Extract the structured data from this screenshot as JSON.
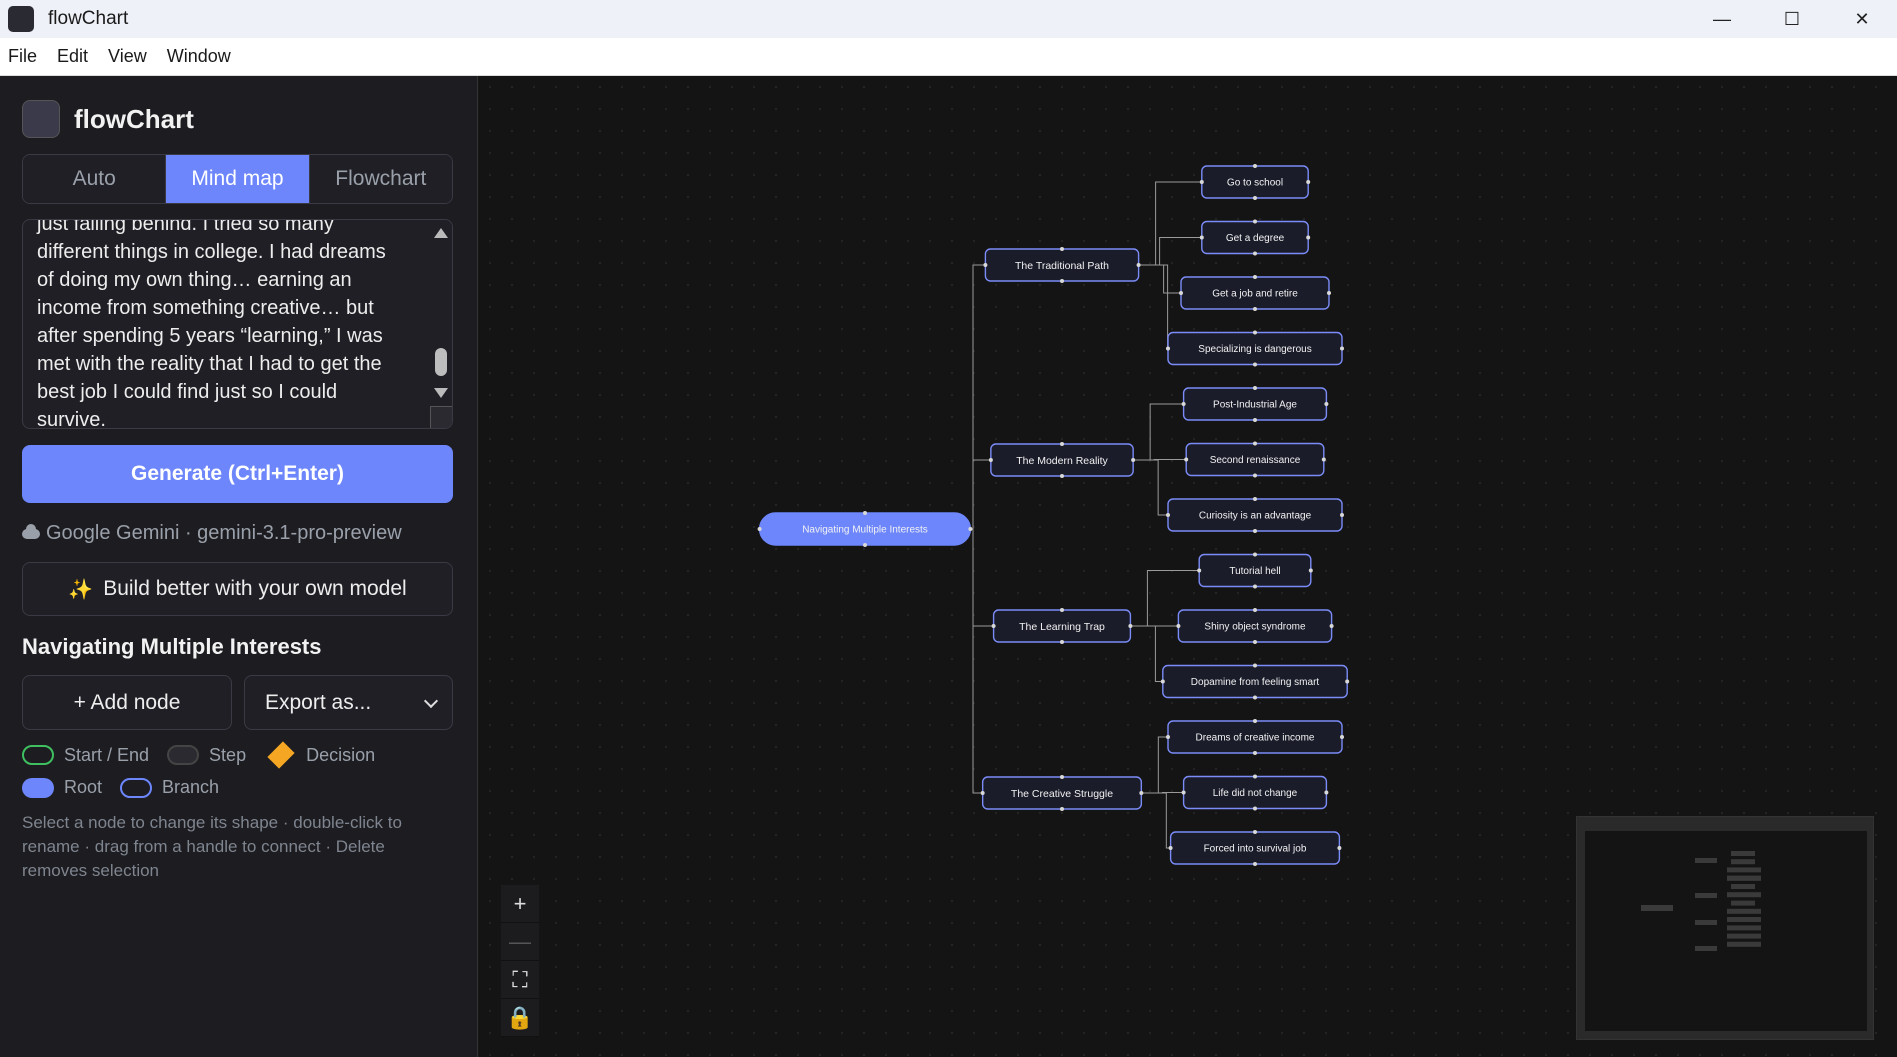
{
  "window": {
    "title": "flowChart",
    "controls": {
      "minimize": "—",
      "maximize": "☐",
      "close": "✕"
    }
  },
  "menu": [
    "File",
    "Edit",
    "View",
    "Window"
  ],
  "sidebar": {
    "brand": "flowChart",
    "tabs": [
      {
        "label": "Auto",
        "active": false
      },
      {
        "label": "Mind map",
        "active": true
      },
      {
        "label": "Flowchart",
        "active": false
      }
    ],
    "input_lines": [
      "just falling behind. I tried so many",
      "different things in college. I had dreams",
      "of doing my own thing… earning an",
      "income from something creative… but",
      "after spending 5 years “learning,” I was",
      "met with the reality that I had to get the",
      "best job I could find just so I could",
      "survive."
    ],
    "generate_label": "Generate (Ctrl+Enter)",
    "model_label": "Google Gemini · gemini-3.1-pro-preview",
    "own_model_label": "Build better with your own model",
    "doc_title": "Navigating Multiple Interests",
    "add_node_label": "+ Add node",
    "export_label": "Export as...",
    "legend": {
      "start_end": "Start / End",
      "step": "Step",
      "decision": "Decision",
      "root": "Root",
      "branch": "Branch"
    },
    "hint": "Select a node to change its shape · double-click to rename · drag from a handle to connect · Delete removes selection"
  },
  "mindmap": {
    "root": "Navigating Multiple Interests",
    "branches": [
      {
        "label": "The Traditional Path",
        "children": [
          "Go to school",
          "Get a degree",
          "Get a job and retire",
          "Specializing is dangerous"
        ]
      },
      {
        "label": "The Modern Reality",
        "children": [
          "Post-Industrial Age",
          "Second renaissance",
          "Curiosity is an advantage"
        ]
      },
      {
        "label": "The Learning Trap",
        "children": [
          "Tutorial hell",
          "Shiny object syndrome",
          "Dopamine from feeling smart"
        ]
      },
      {
        "label": "The Creative Struggle",
        "children": [
          "Dreams of creative income",
          "Life did not change",
          "Forced into survival job"
        ]
      }
    ]
  },
  "zoom": {
    "in": "+",
    "out": "—",
    "fit": "⛶",
    "lock": "🔒"
  },
  "colors": {
    "accent": "#6d86fb",
    "node_border": "#7b8cf8",
    "node_fill": "#1a1c2a",
    "edge": "#9a9a9a"
  }
}
